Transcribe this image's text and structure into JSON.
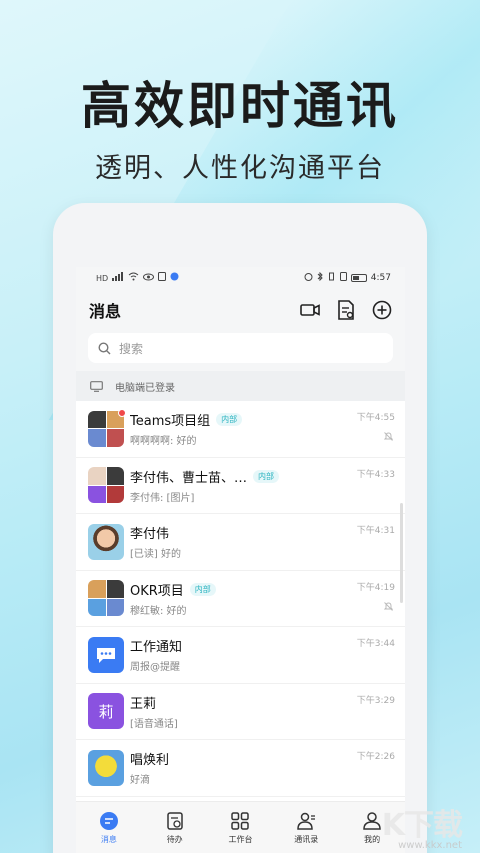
{
  "hero": {
    "headline": "高效即时通讯",
    "subline": "透明、人性化沟通平台"
  },
  "statusbar": {
    "time": "4:57",
    "left_label": "HD"
  },
  "appbar": {
    "title": "消息"
  },
  "search": {
    "placeholder": "搜索"
  },
  "pc_status": {
    "label": "电脑端已登录"
  },
  "chats": [
    {
      "name": "Teams项目组",
      "tag": "内部",
      "preview": "啊啊啊啊: 好的",
      "time": "下午4:55",
      "muted": true,
      "unread_dot": true
    },
    {
      "name": "李付伟、曹士苗、…",
      "tag": "内部",
      "preview": "李付伟: [图片]",
      "time": "下午4:33",
      "muted": false,
      "unread_dot": false
    },
    {
      "name": "李付伟",
      "tag": "",
      "preview": "[已读] 好的",
      "time": "下午4:31",
      "muted": false,
      "unread_dot": false
    },
    {
      "name": "OKR项目",
      "tag": "内部",
      "preview": "穆红敏: 好的",
      "time": "下午4:19",
      "muted": true,
      "unread_dot": false
    },
    {
      "name": "工作通知",
      "tag": "",
      "preview": "周报@提醒",
      "time": "下午3:44",
      "muted": false,
      "unread_dot": false
    },
    {
      "name": "王莉",
      "tag": "",
      "preview": "[语音通话]",
      "time": "下午3:29",
      "muted": false,
      "unread_dot": false,
      "avatar_text": "莉"
    },
    {
      "name": "唱焕利",
      "tag": "",
      "preview": "好滴",
      "time": "下午2:26",
      "muted": false,
      "unread_dot": false
    }
  ],
  "tabs": [
    {
      "label": "消息",
      "icon": "message-icon"
    },
    {
      "label": "待办",
      "icon": "todo-icon"
    },
    {
      "label": "工作台",
      "icon": "workbench-icon"
    },
    {
      "label": "通讯录",
      "icon": "contacts-icon"
    },
    {
      "label": "我的",
      "icon": "profile-icon"
    }
  ],
  "watermark": {
    "text": "K下载",
    "url": "www.kkx.net"
  },
  "colors": {
    "accent": "#3a7bf3",
    "tag_text": "#2bb3c0",
    "notice_icon": "#3a7bf3",
    "purple_avatar": "#8a52e0"
  }
}
